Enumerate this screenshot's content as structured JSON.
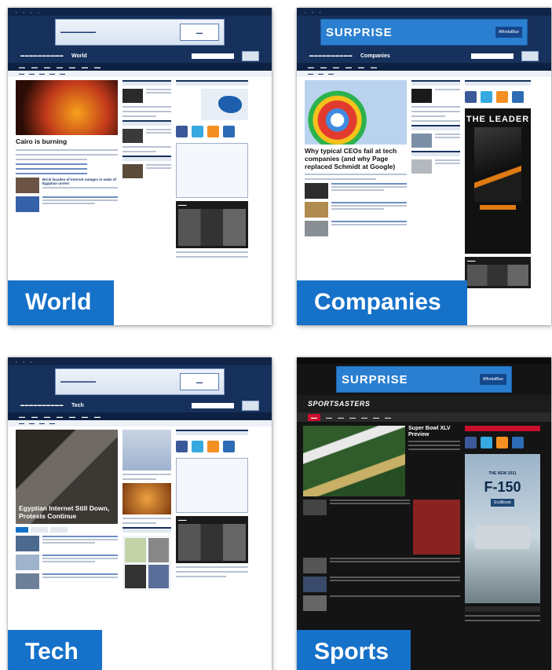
{
  "tiles": [
    {
      "label": "World",
      "section": "World",
      "headline": "Cairo is burning",
      "headline2": "Brick facades of Internet outages in wake of Egyptian unrest"
    },
    {
      "label": "Companies",
      "section": "Companies",
      "headline": "Why typical CEOs fail at tech companies (and why Page replaced Schmidt at Google)",
      "promo": "THE LEADER"
    },
    {
      "label": "Tech",
      "section": "Tech",
      "headline": "Egyptian Internet Still Down, Protests Continue"
    },
    {
      "label": "Sports",
      "section": "SPORTSASTERS",
      "headline": "Super Bowl XLV Preview",
      "ad_big": "F-150",
      "ad_small": "THE NEW 2011",
      "ad_tag": "EcoBoost"
    }
  ],
  "ads": {
    "surprise": "SURPRISE",
    "bcbs": "AffordaBlue"
  },
  "colors": {
    "label_bg": "#1671c9",
    "header": "#16315c",
    "sports_red": "#c8102e"
  }
}
